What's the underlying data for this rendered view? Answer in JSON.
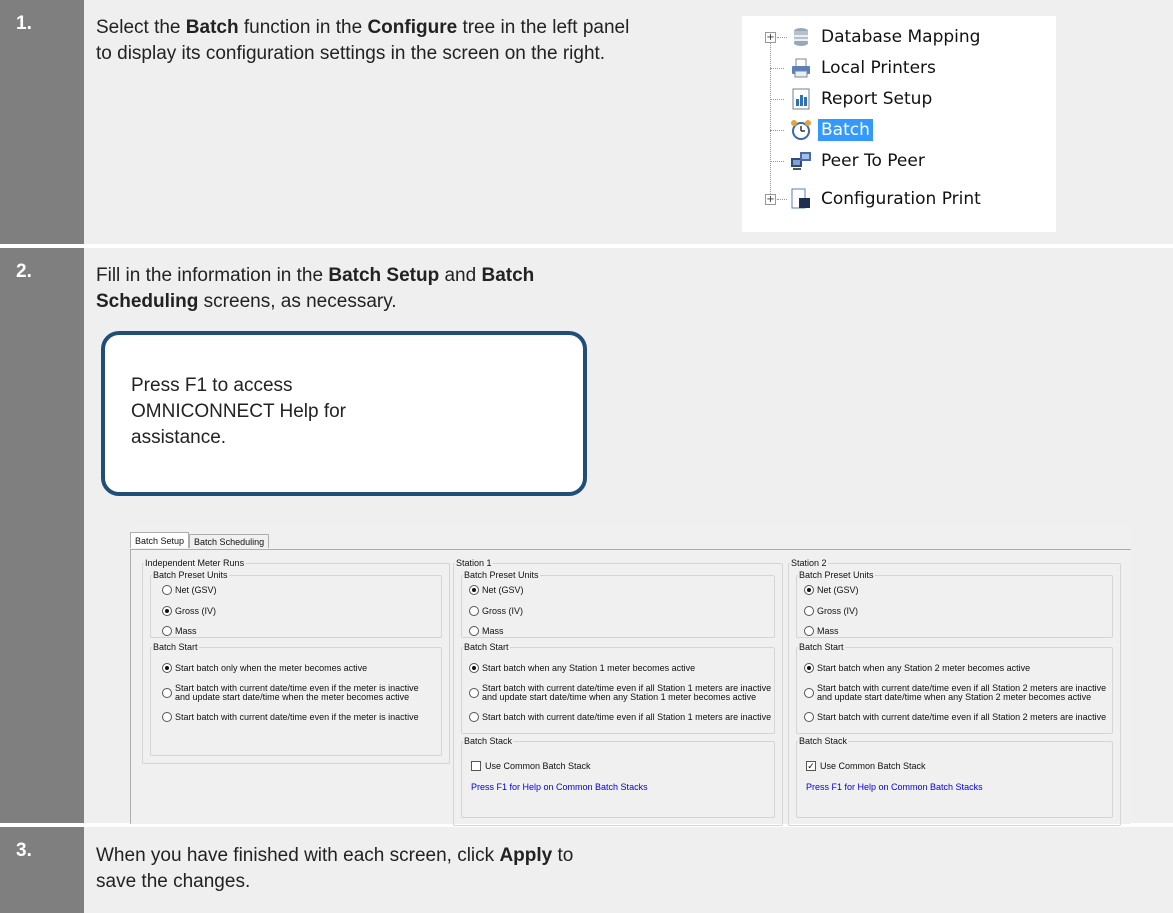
{
  "steps": [
    {
      "number": "1.",
      "text": {
        "part1": "Select the ",
        "bold1": "Batch",
        "part2": " function in the ",
        "bold2": "Configure",
        "part3": " tree in the left panel to display its configuration settings in the screen on the right."
      }
    },
    {
      "number": "2.",
      "text": {
        "part1": "Fill in the information in the ",
        "bold1": "Batch Setup",
        "part2": " and ",
        "bold2": "Batch Scheduling",
        "part3": " screens, as necessary."
      }
    },
    {
      "number": "3.",
      "text": {
        "part1": "When you have finished with each screen, click ",
        "bold1": "Apply",
        "part2": " to save the changes."
      }
    }
  ],
  "tree": {
    "items": [
      {
        "label": "Database Mapping",
        "icon": "database-icon",
        "expandable": true
      },
      {
        "label": "Local Printers",
        "icon": "printer-icon",
        "expandable": false
      },
      {
        "label": "Report Setup",
        "icon": "report-icon",
        "expandable": false
      },
      {
        "label": "Batch",
        "icon": "alarm-clock-icon",
        "expandable": false,
        "selected": true
      },
      {
        "label": "Peer To Peer",
        "icon": "network-computers-icon",
        "expandable": false
      },
      {
        "label": "Configuration Print",
        "icon": "document-print-icon",
        "expandable": true
      }
    ],
    "selected_color": "#3399ff"
  },
  "callout": {
    "text": "Press F1 to access OMNICONNECT Help for assistance.",
    "border_color": "#1f4e79"
  },
  "dialog": {
    "tabs": [
      "Batch Setup",
      "Batch Scheduling"
    ],
    "active_tab": "Batch Setup",
    "groups": [
      {
        "title": "Independent Meter Runs",
        "preset_units": {
          "title": "Batch Preset Units",
          "options": [
            "Net (GSV)",
            "Gross (IV)",
            "Mass"
          ],
          "selected": "Gross (IV)"
        },
        "batch_start": {
          "title": "Batch Start",
          "options": [
            "Start batch only when the meter becomes active",
            "Start batch with current date/time even if the meter is inactive",
            "Start batch with current date/time even if the meter is inactive"
          ],
          "option2_line2": "and update start date/time when the meter becomes active",
          "selected_index": 0
        }
      },
      {
        "title": "Station 1",
        "preset_units": {
          "title": "Batch Preset Units",
          "options": [
            "Net (GSV)",
            "Gross (IV)",
            "Mass"
          ],
          "selected": "Net (GSV)"
        },
        "batch_start": {
          "title": "Batch Start",
          "options": [
            "Start batch when any Station 1 meter becomes active",
            "Start batch with current date/time even if all Station 1 meters are inactive",
            "Start batch with current date/time even if all Station 1 meters are inactive"
          ],
          "option2_line2": "and update start date/time when any Station 1 meter becomes active",
          "selected_index": 0
        },
        "batch_stack": {
          "title": "Batch Stack",
          "checkbox_label": "Use Common Batch Stack",
          "checked": false,
          "help_link": "Press F1 for Help on Common Batch Stacks"
        }
      },
      {
        "title": "Station 2",
        "preset_units": {
          "title": "Batch Preset Units",
          "options": [
            "Net (GSV)",
            "Gross (IV)",
            "Mass"
          ],
          "selected": "Net (GSV)"
        },
        "batch_start": {
          "title": "Batch Start",
          "options": [
            "Start batch when any Station 2 meter becomes active",
            "Start batch with current date/time even if all Station 2 meters are inactive",
            "Start batch with current date/time even if all Station 2 meters are inactive"
          ],
          "option2_line2": "and update start date/time when any Station 2 meter becomes active",
          "selected_index": 0
        },
        "batch_stack": {
          "title": "Batch Stack",
          "checkbox_label": "Use Common Batch Stack",
          "checked": true,
          "help_link": "Press F1 for Help on Common Batch Stacks"
        }
      }
    ],
    "link_color": "#0000ee"
  },
  "colors": {
    "step_number_bg": "#7f7f7f",
    "step_bg": "#efefef"
  }
}
